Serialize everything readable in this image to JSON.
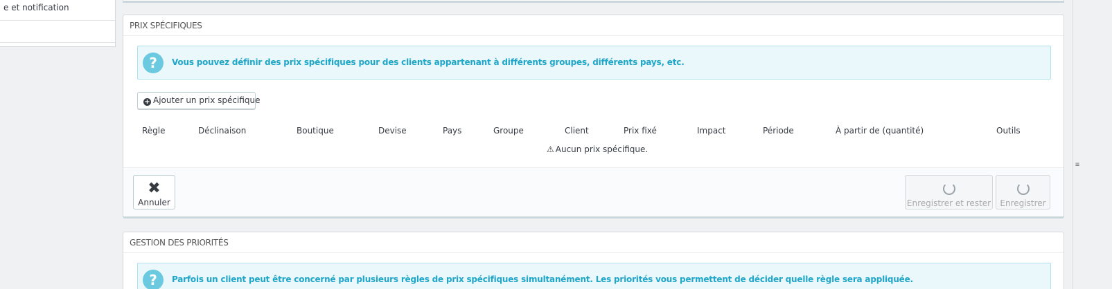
{
  "sidebar": {
    "items": [
      {
        "label": "e et notification"
      },
      {
        "label": ""
      }
    ]
  },
  "specific_prices": {
    "title": "PRIX SPÉCIFIQUES",
    "info": "Vous pouvez définir des prix spécifiques pour des clients appartenant à différents groupes, différents pays, etc.",
    "add_button": "Ajouter un prix spécifique",
    "columns": [
      "Règle",
      "Déclinaison",
      "Boutique",
      "Devise",
      "Pays",
      "Groupe",
      "Client",
      "Prix fixé",
      "Impact",
      "Période",
      "À partir de (quantité)",
      "Outils"
    ],
    "empty_text": "Aucun prix spécifique.",
    "cancel_label": "Annuler",
    "save_stay_label": "Enregistrer et rester",
    "save_label": "Enregistrer"
  },
  "priorities": {
    "title": "GESTION DES PRIORITÉS",
    "info": "Parfois un client peut être concerné par plusieurs règles de prix spécifiques simultanément. Les priorités vous permettent de décider quelle règle sera appliquée."
  },
  "icons": {
    "info": "question-icon",
    "add": "plus-circle-icon",
    "warning": "warning-icon",
    "cancel": "close-icon",
    "loading": "spinner-icon"
  },
  "colors": {
    "info_text": "#1fa6c8",
    "info_bg": "#eaf7fb",
    "info_icon": "#6bc9e0"
  }
}
